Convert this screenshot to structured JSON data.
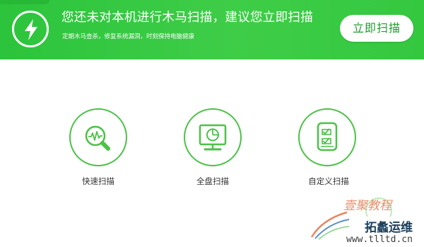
{
  "banner": {
    "headline": "您还未对本机进行木马扫描，建议您立即扫描",
    "subline": "定期木马查杀，修复系统漏洞，时刻保持电脑健康",
    "scan_button": "立即扫描",
    "icon": "lightning-bolt-icon",
    "accent_color": "#33c53e"
  },
  "scan_options": [
    {
      "label": "快速扫描",
      "icon": "quick-scan-magnifier-icon"
    },
    {
      "label": "全盘扫描",
      "icon": "full-scan-monitor-icon"
    },
    {
      "label": "自定义扫描",
      "icon": "custom-scan-checklist-icon"
    }
  ],
  "watermark": {
    "title": "壹聚教程",
    "subtitle": "拓蠡运维",
    "url": "www.tlltd.cn"
  }
}
